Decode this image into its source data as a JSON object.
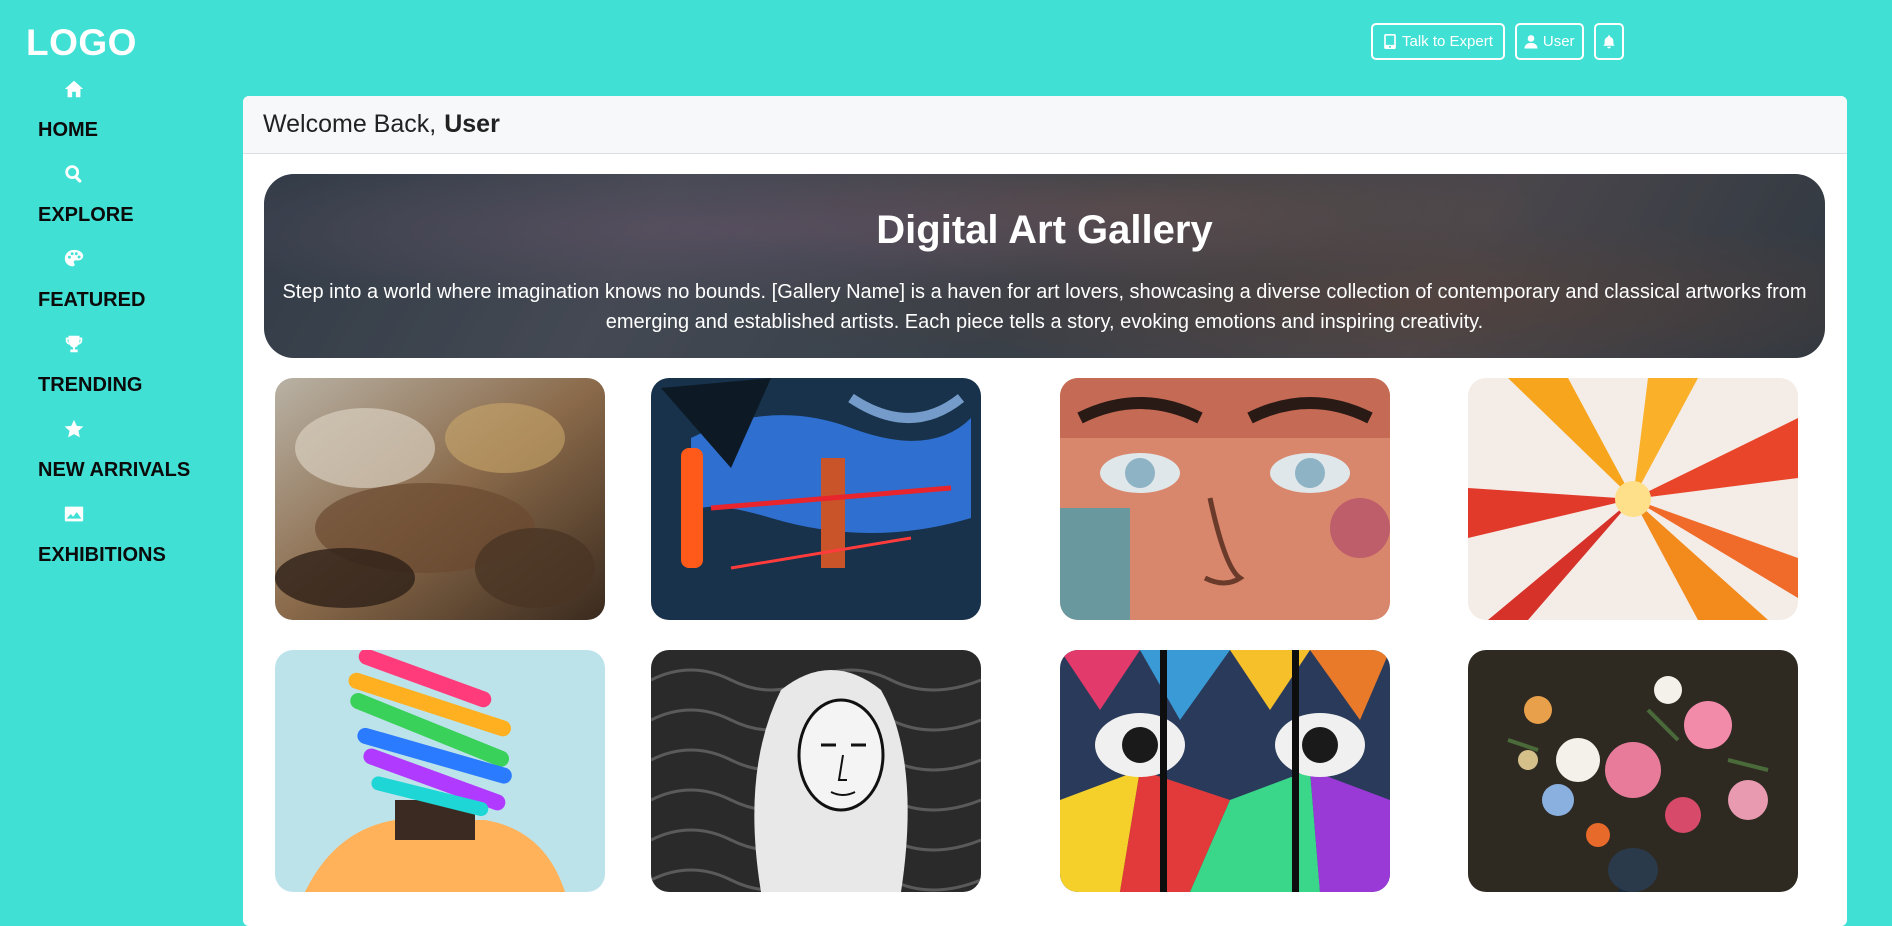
{
  "logo": "LOGO",
  "nav": [
    {
      "label": "HOME",
      "icon": "home-icon"
    },
    {
      "label": "EXPLORE",
      "icon": "search-icon"
    },
    {
      "label": "FEATURED",
      "icon": "palette-icon"
    },
    {
      "label": "TRENDING",
      "icon": "trophy-icon"
    },
    {
      "label": "NEW ARRIVALS",
      "icon": "star-icon"
    },
    {
      "label": "EXHIBITIONS",
      "icon": "image-icon"
    }
  ],
  "topbar": {
    "talk_label": "Talk to Expert",
    "user_label": "User",
    "bell_icon": "bell-icon"
  },
  "header": {
    "greeting": "Welcome Back,",
    "username": "User"
  },
  "hero": {
    "title": "Digital Art Gallery",
    "description": "Step into a world where imagination knows no bounds. [Gallery Name] is a haven for art lovers, showcasing a diverse collection of contemporary and classical artworks from emerging and established artists. Each piece tells a story, evoking emotions and inspiring creativity."
  },
  "gallery": {
    "items": [
      {
        "name": "baroque-ceiling-painting"
      },
      {
        "name": "blue-abstract-painting"
      },
      {
        "name": "graffiti-face-mural"
      },
      {
        "name": "orange-fluid-art"
      },
      {
        "name": "rainbow-brushstroke-portrait"
      },
      {
        "name": "woman-ink-illustration"
      },
      {
        "name": "geometric-face-mural"
      },
      {
        "name": "flower-still-life"
      }
    ]
  },
  "colors": {
    "background": "#40E0D5",
    "text_dark": "#0b0b0b",
    "card": "#ffffff",
    "header_bg": "#f7f8f9"
  }
}
